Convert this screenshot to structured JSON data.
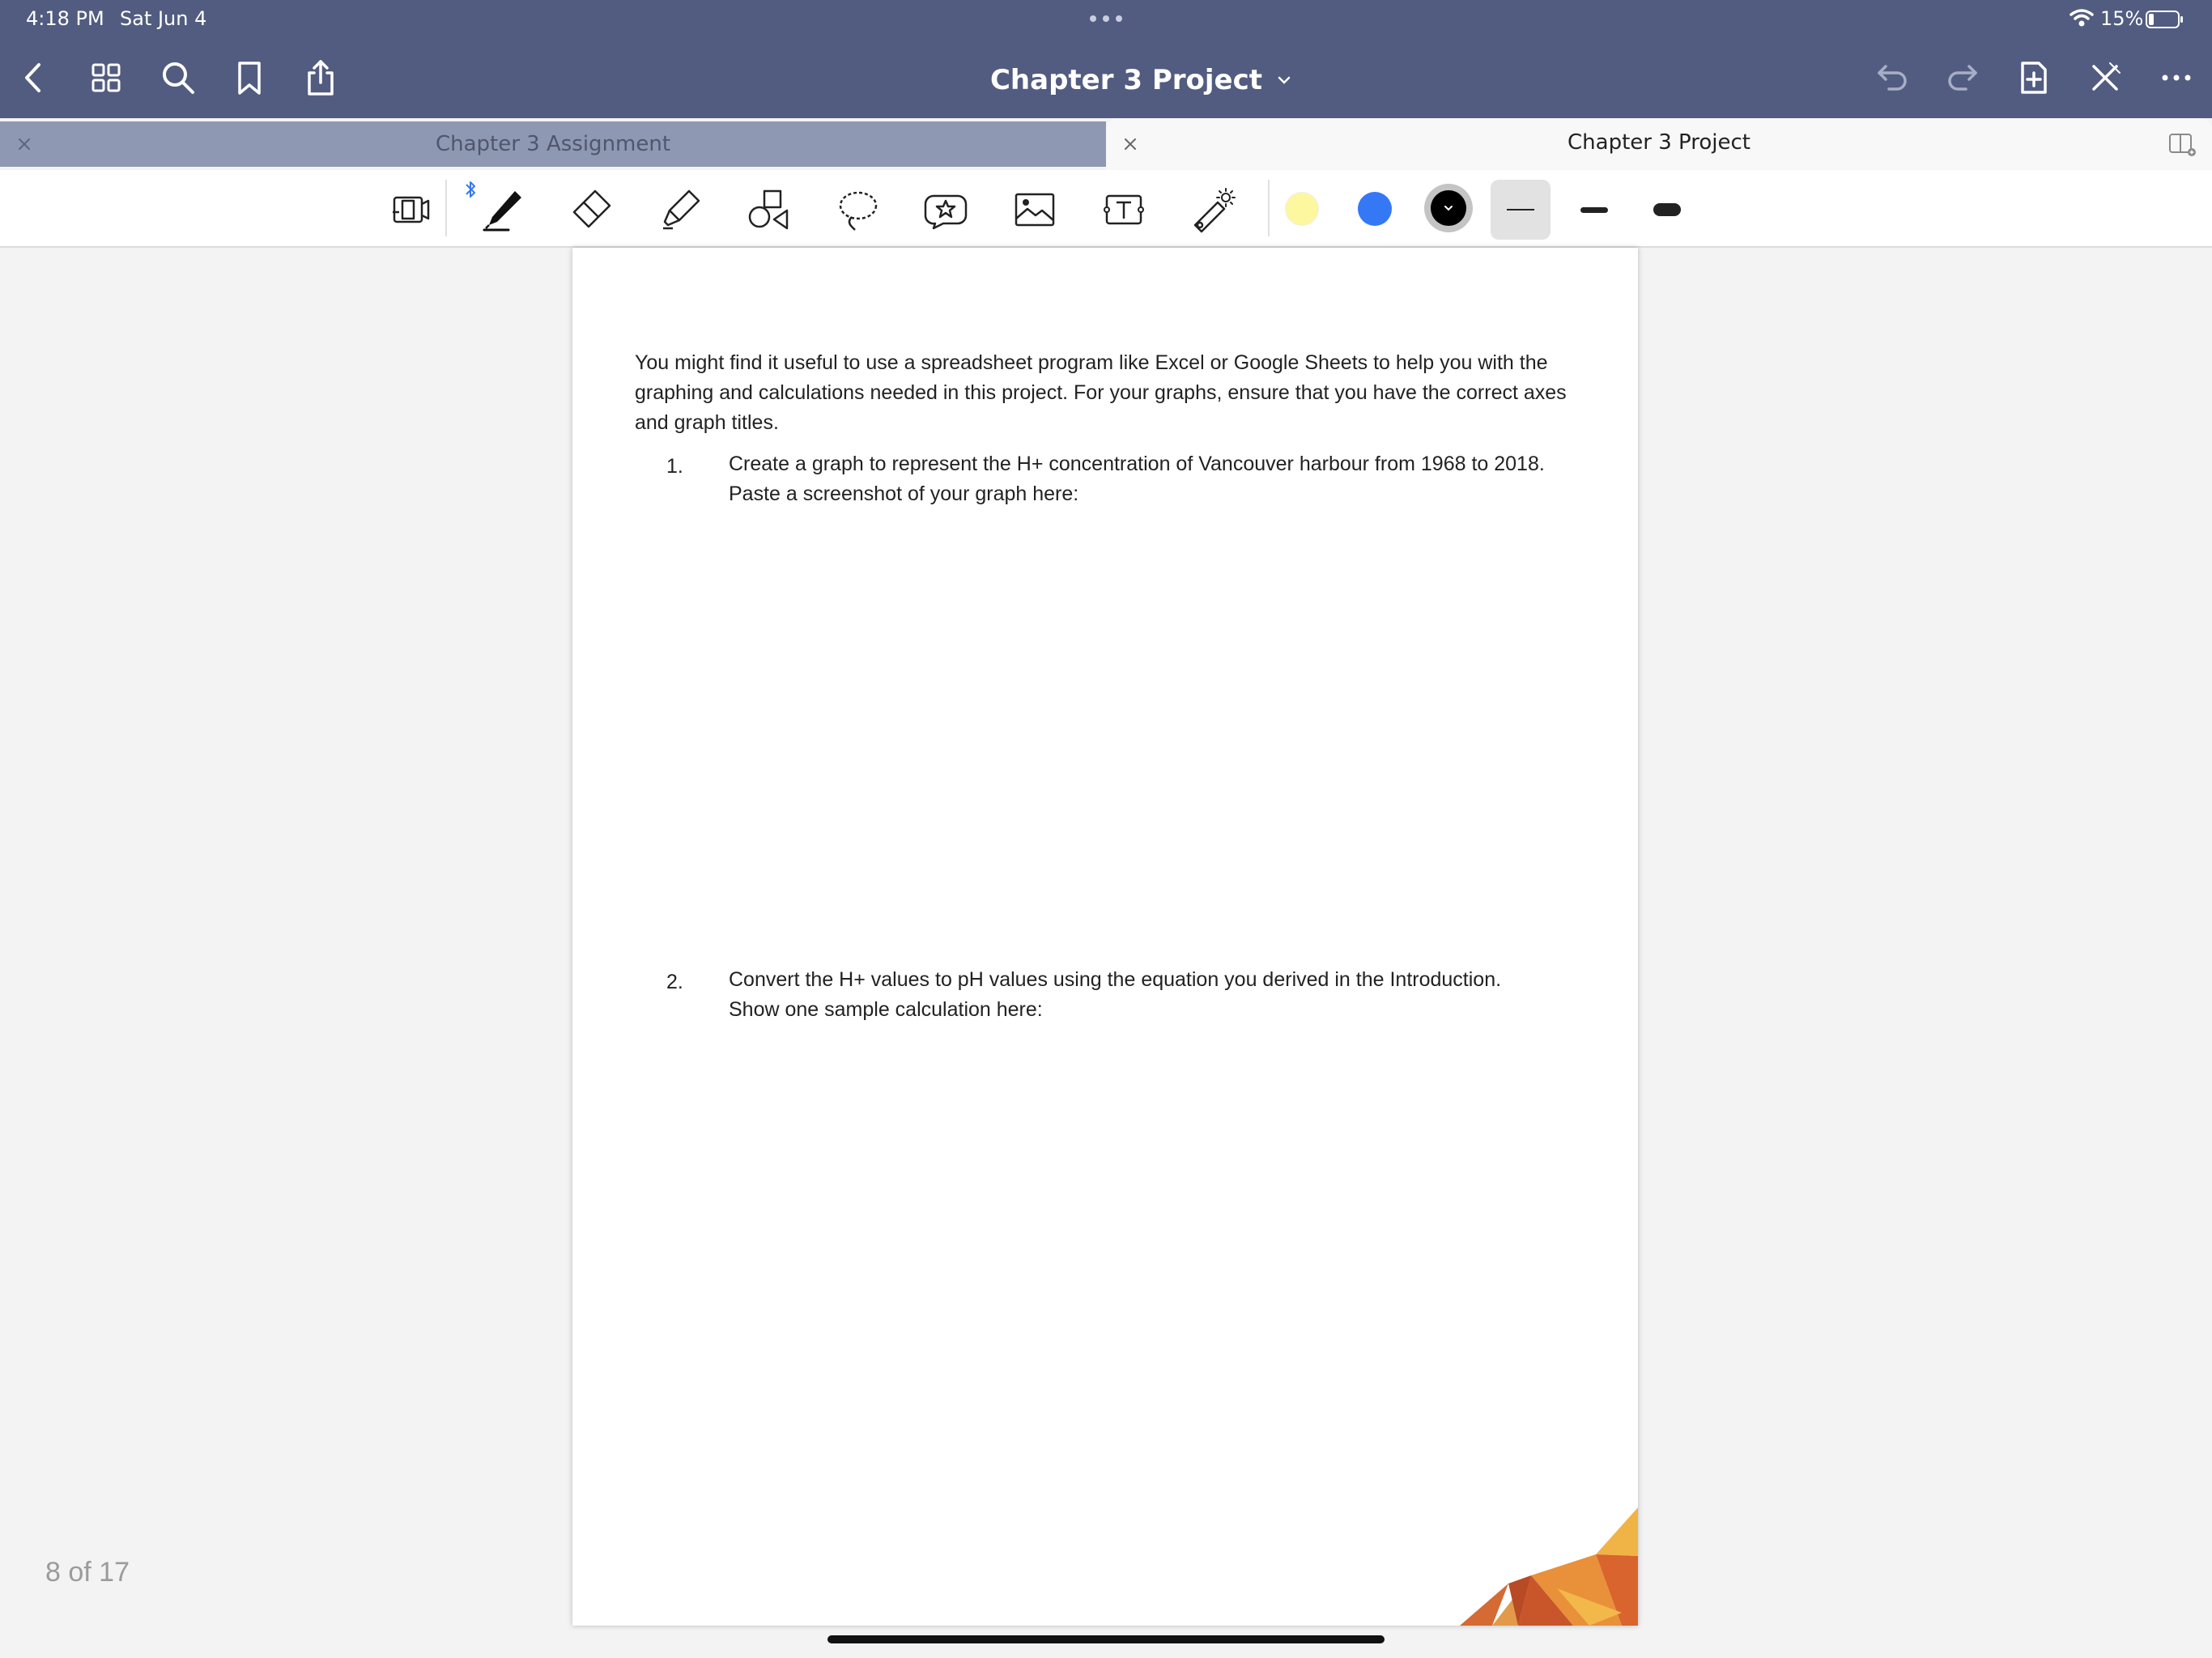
{
  "status_bar": {
    "time": "4:18 PM",
    "date": "Sat Jun 4",
    "battery": "15%"
  },
  "nav": {
    "title": "Chapter 3 Project",
    "left_icons": [
      "back-icon",
      "thumbnails-grid-icon",
      "search-icon",
      "bookmark-icon",
      "share-icon"
    ],
    "right_icons": [
      "undo-icon",
      "redo-icon",
      "add-page-icon",
      "close-pen-mode-icon",
      "more-icon"
    ]
  },
  "tabs": [
    {
      "label": "Chapter 3 Assignment",
      "active": false
    },
    {
      "label": "Chapter 3 Project",
      "active": true
    }
  ],
  "toolbar": {
    "tools": [
      "presentation-tool-icon",
      "pen-tool-icon",
      "eraser-tool-icon",
      "highlighter-tool-icon",
      "shapes-tool-icon",
      "lasso-tool-icon",
      "sticker-tool-icon",
      "image-tool-icon",
      "text-tool-icon",
      "laser-pointer-tool-icon"
    ],
    "selected_tool": "pen",
    "colors": [
      "#fdf8a0",
      "#3478f6",
      "#000000"
    ],
    "selected_color": "#000000",
    "stroke_widths": [
      "thin",
      "medium",
      "thick"
    ],
    "selected_width": "thin"
  },
  "document": {
    "intro": "You might find it useful to use a spreadsheet program like Excel or Google Sheets to help you with the graphing and calculations needed in this project. For your graphs, ensure that you have the correct axes and graph titles.",
    "items": [
      {
        "num": "1.",
        "line1": "Create a graph to represent the H+ concentration of Vancouver harbour from 1968 to 2018.",
        "line2": "Paste a screenshot of your graph here:"
      },
      {
        "num": "2.",
        "line1": "Convert the H+ values to pH values using the equation you derived in the Introduction.",
        "line2": "Show one sample calculation here:"
      }
    ]
  },
  "page_indicator": "8 of 17"
}
